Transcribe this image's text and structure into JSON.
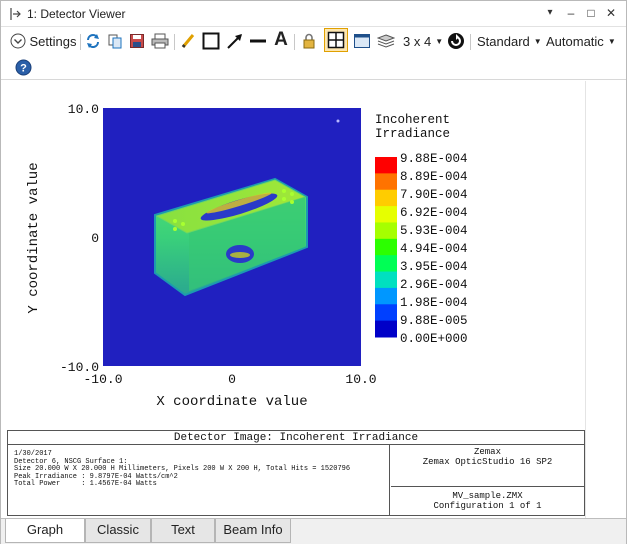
{
  "window": {
    "title": "1: Detector Viewer",
    "controls": {
      "dropdown": "▾",
      "minimize": "–",
      "restore": "□",
      "close": "✕"
    }
  },
  "toolbar": {
    "settings_label": "Settings",
    "layout_label": "3 x 4",
    "style_label": "Standard",
    "scale_label": "Automatic",
    "text_tool_glyph": "A"
  },
  "chart_data": {
    "type": "heatmap",
    "xlabel": "X coordinate value",
    "ylabel": "Y coordinate value",
    "xlim": [
      -10.0,
      10.0
    ],
    "ylim": [
      -10.0,
      10.0
    ],
    "x_ticks": [
      "-10.0",
      "0",
      "10.0"
    ],
    "y_ticks": [
      "10.0",
      "0",
      "-10.0"
    ],
    "legend_title": [
      "Incoherent",
      "Irradiance"
    ],
    "colorbar_ticks": [
      "9.88E-004",
      "8.89E-004",
      "7.90E-004",
      "6.92E-004",
      "5.93E-004",
      "4.94E-004",
      "3.95E-004",
      "2.96E-004",
      "1.98E-004",
      "9.88E-005",
      "0.00E+000"
    ],
    "colorbar_colors": [
      "#ff0000",
      "#ff7300",
      "#ffcc00",
      "#e6ff00",
      "#a6ff00",
      "#2cff00",
      "#00ff55",
      "#00e0c0",
      "#0097ff",
      "#0040ff",
      "#0000c8"
    ],
    "background_color": "#2020c0"
  },
  "info": {
    "title": "Detector Image: Incoherent Irradiance",
    "left_lines": [
      "1/30/2017",
      "Detector 6, NSCG Surface 1:",
      "Size 20.000 W X 20.000 H Millimeters, Pixels 200 W X 200 H, Total Hits = 1520796",
      "Peak Irradiance : 9.8797E-04 Watts/cm^2",
      "Total Power     : 1.4567E-04 Watts"
    ],
    "right_top_lines": [
      "Zemax",
      "Zemax OpticStudio 16 SP2"
    ],
    "right_bottom_lines": [
      "MV_sample.ZMX",
      "Configuration 1 of 1"
    ]
  },
  "tabs": [
    {
      "label": "Graph",
      "active": true
    },
    {
      "label": "Classic",
      "active": false
    },
    {
      "label": "Text",
      "active": false
    },
    {
      "label": "Beam Info",
      "active": false
    }
  ]
}
